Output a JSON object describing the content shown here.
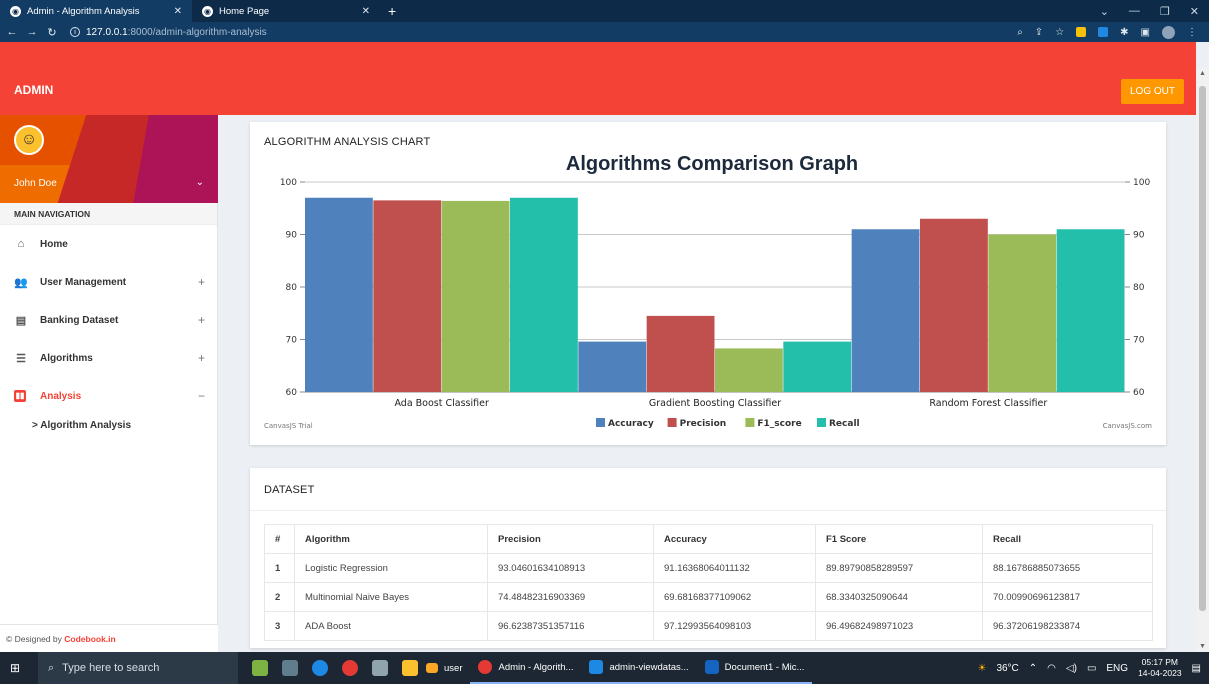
{
  "browser": {
    "tabs": [
      {
        "title": "Admin - Algorithm Analysis",
        "active": true
      },
      {
        "title": "Home Page",
        "active": false
      }
    ],
    "url_host": "127.0.0.1",
    "url_rest": ":8000/admin-algorithm-analysis"
  },
  "header": {
    "brand": "ADMIN",
    "logout_label": "LOG OUT"
  },
  "sidebar": {
    "user_name": "John Doe",
    "nav_header": "MAIN NAVIGATION",
    "items": [
      {
        "label": "Home",
        "icon": "home-icon",
        "toggle": ""
      },
      {
        "label": "User Management",
        "icon": "people-icon",
        "toggle": "+"
      },
      {
        "label": "Banking Dataset",
        "icon": "clipboard-icon",
        "toggle": "+"
      },
      {
        "label": "Algorithms",
        "icon": "list-icon",
        "toggle": "+"
      },
      {
        "label": "Analysis",
        "icon": "bar-chart-icon",
        "toggle": "−"
      }
    ],
    "sub_item": "> Algorithm Analysis",
    "footer_prefix": "© Designed by ",
    "footer_brand": "Codebook.in"
  },
  "chart_card": {
    "title": "ALGORITHM ANALYSIS CHART",
    "trial_left": "CanvasJS Trial",
    "trial_right": "CanvasJS.com"
  },
  "chart_data": {
    "type": "bar",
    "title": "Algorithms Comparison Graph",
    "categories": [
      "Ada Boost Classifier",
      "Gradient Boosting Classifier",
      "Random Forest Classifier"
    ],
    "series": [
      {
        "name": "Accuracy",
        "color": "#4f81bc",
        "values": [
          97,
          69.6,
          91
        ]
      },
      {
        "name": "Precision",
        "color": "#c0504e",
        "values": [
          96.5,
          74.5,
          93
        ]
      },
      {
        "name": "F1_score",
        "color": "#9bbb58",
        "values": [
          96.4,
          68.3,
          90
        ]
      },
      {
        "name": "Recall",
        "color": "#23bfaa",
        "values": [
          97,
          69.6,
          91
        ]
      }
    ],
    "ylim": [
      60,
      100
    ],
    "yticks": [
      60,
      70,
      80,
      90,
      100
    ],
    "legend": "bottom",
    "grid": true
  },
  "dataset": {
    "title": "DATASET",
    "columns": [
      "#",
      "Algorithm",
      "Precision",
      "Accuracy",
      "F1 Score",
      "Recall"
    ],
    "rows": [
      [
        "1",
        "Logistic Regression",
        "93.04601634108913",
        "91.16368064011132",
        "89.89790858289597",
        "88.16786885073655"
      ],
      [
        "2",
        "Multinomial Naive Bayes",
        "74.48482316903369",
        "69.68168377109062",
        "68.3340325090644",
        "70.00990696123817"
      ],
      [
        "3",
        "ADA Boost",
        "96.62387351357116",
        "97.12993564098103",
        "96.49682498971023",
        "96.37206198233874"
      ]
    ]
  },
  "taskbar": {
    "search_placeholder": "Type here to search",
    "apps": [
      "user",
      "Admin - Algorith...",
      "admin-viewdatas...",
      "Document1 - Mic..."
    ],
    "weather": "36°C",
    "lang": "ENG",
    "time": "05:17 PM",
    "date": "14-04-2023"
  }
}
